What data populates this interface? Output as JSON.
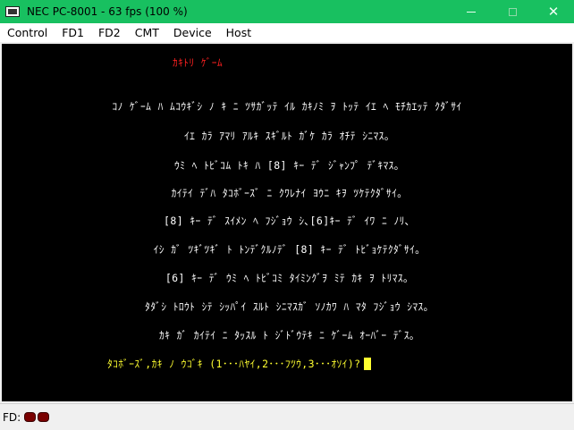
{
  "window": {
    "title": "NEC PC-8001 - 63 fps (100 %)",
    "icon": "computer-icon",
    "controls": {
      "minimize": "minimize-icon",
      "maximize": "maximize-icon",
      "close": "close-icon",
      "close_glyph": "✕"
    }
  },
  "menubar": {
    "items": [
      "Control",
      "FD1",
      "FD2",
      "CMT",
      "Device",
      "Host"
    ]
  },
  "screen": {
    "title": "ｶｷﾄﾘ ｹﾞｰﾑ",
    "lines": [
      "ｺﾉ ｹﾞｰﾑ ﾊ ﾑｺｳｷﾞｼ ﾉ ｷ ﾆ ﾂｻｶﾞｯﾃ ｲﾙ ｶｷﾉﾐ ｦ ﾄｯﾃ ｲｴ ﾍ ﾓﾁｶｴｯﾃ ｸﾀﾞｻｲ",
      "ｲｴ ｶﾗ ｱﾏﾘ ｱﾙｷ ｽｷﾞﾙﾄ ｶﾞｹ ｶﾗ ｵﾁﾃ ｼﾆﾏｽ｡",
      "ｳﾐ ﾍ ﾄﾋﾞｺﾑ ﾄｷ ﾊ [8] ｷｰ ﾃﾞ ｼﾞｬﾝﾌﾟ ﾃﾞｷﾏｽ｡",
      "ｶｲﾃｲ ﾃﾞﾊ ﾀｺﾎﾞｰｽﾞ ﾆ ｸﾜﾚﾅｲ ﾖｳﾆ ｷｦ ﾂｹﾃｸﾀﾞｻｲ｡",
      "[8] ｷｰ ﾃﾞ ｽｲﾒﾝ ﾍ ﾌｼﾞｮｳ ｼ､[6]ｷｰ ﾃﾞ ｲﾜ ﾆ ﾉﾘ､",
      "ｲｼ ｶﾞ ﾂｷﾞﾂｷﾞ ﾄ ﾄﾝﾃﾞｸﾙﾉﾃﾞ [8] ｷｰ ﾃﾞ ﾄﾋﾞｮｹﾃｸﾀﾞｻｲ｡",
      "[6] ｷｰ ﾃﾞ ｳﾐ ﾍ ﾄﾋﾞｺﾐ ﾀｲﾐﾝｸﾞｦ ﾐﾃ ｶｷ ｦ ﾄﾘﾏｽ｡",
      "ﾀﾀﾞｼ ﾄﾛｳﾄ ｼﾃ ｼｯﾊﾟｲ ｽﾙﾄ ｼﾆﾏｽｶﾞ ｿﾉｶﾜ ﾊ ﾏﾀ ﾌｼﾞｮｳ ｼﾏｽ｡",
      "ｶｷ ｶﾞ ｶｲﾃｲ ﾆ ﾀｯｽﾙ ﾄ ｼﾞﾄﾞｳﾃｷ ﾆ ｹﾞｰﾑ ｵｰﾊﾞｰ ﾃﾞｽ｡"
    ],
    "prompt": "ﾀｺﾎﾞｰｽﾞ,ｶｷ ﾉ ｳｺﾞｷ (1･･･ﾊﾔｲ,2･･･ﾌﾂｳ,3･･･ｵｿｲ)?",
    "colors": {
      "title": "#ff2020",
      "text": "#ffffff",
      "prompt": "#ffff30",
      "background": "#000000"
    }
  },
  "statusbar": {
    "label": "FD:",
    "drive_leds": [
      "fd-led-1",
      "fd-led-2"
    ]
  }
}
